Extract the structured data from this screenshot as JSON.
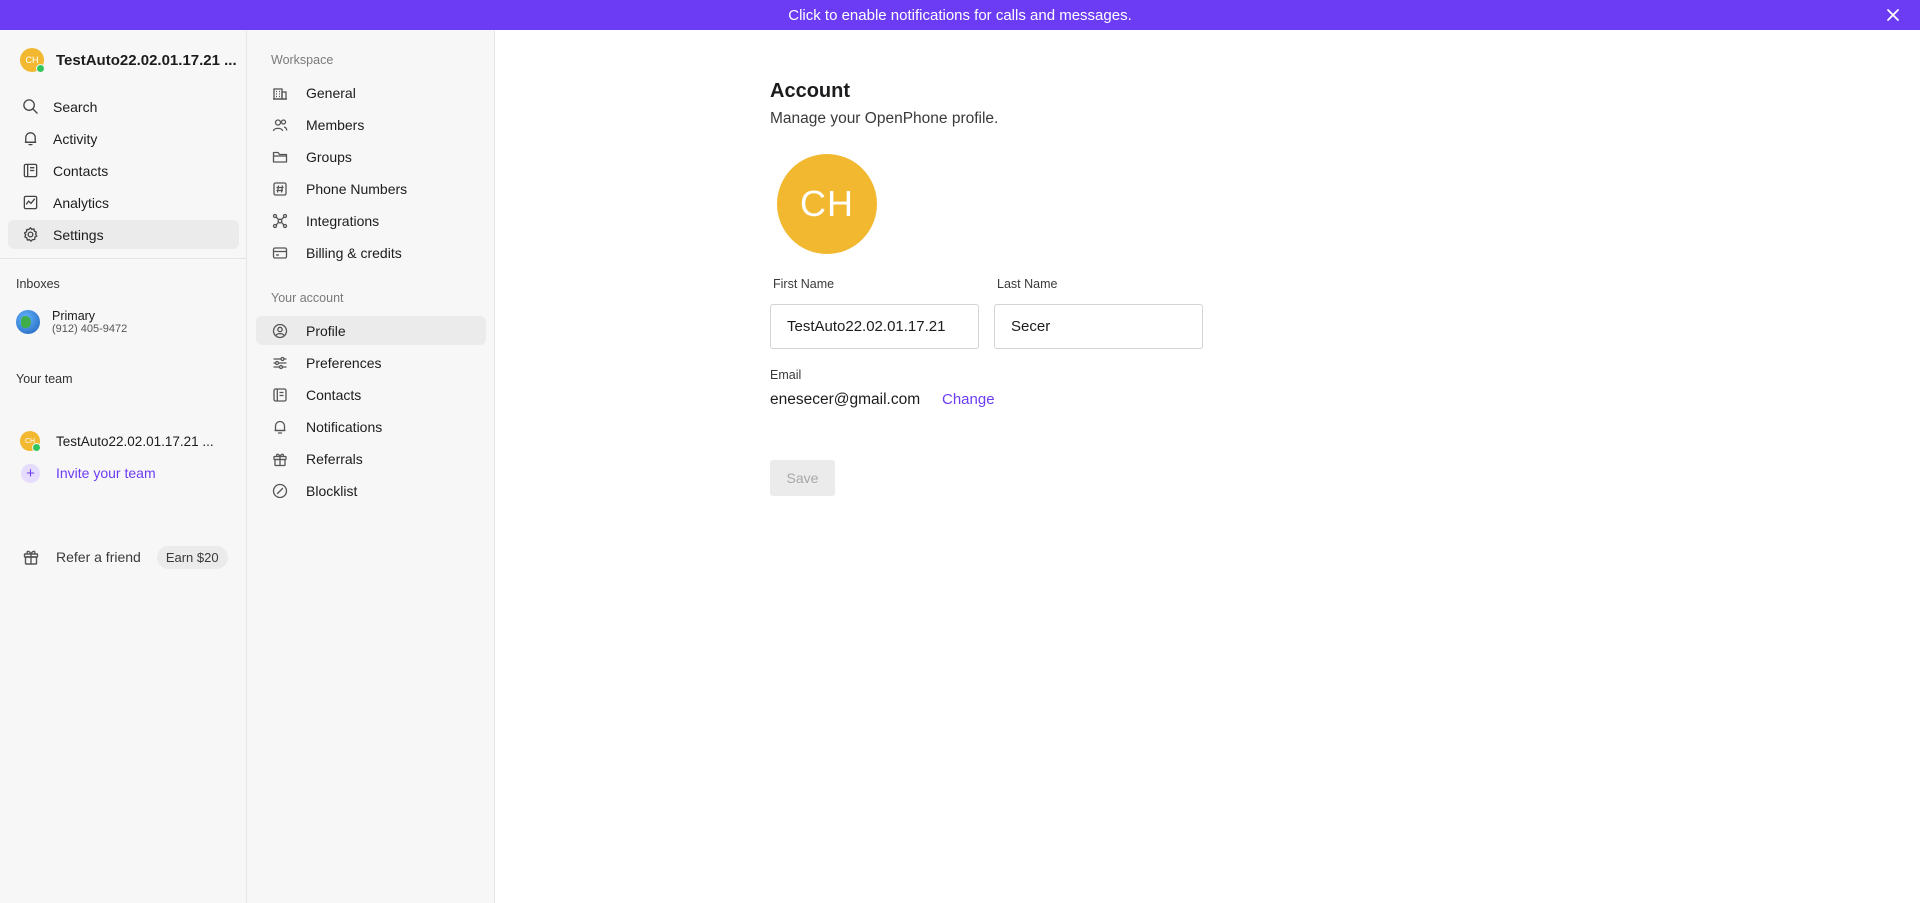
{
  "banner": {
    "text": "Click to enable notifications for calls and messages."
  },
  "org": {
    "initials": "CH",
    "name": "TestAuto22.02.01.17.21 ..."
  },
  "nav": [
    {
      "label": "Search",
      "icon": "search-icon"
    },
    {
      "label": "Activity",
      "icon": "bell-icon"
    },
    {
      "label": "Contacts",
      "icon": "contacts-icon"
    },
    {
      "label": "Analytics",
      "icon": "analytics-icon"
    },
    {
      "label": "Settings",
      "icon": "gear-icon",
      "active": true
    }
  ],
  "inboxes": {
    "label": "Inboxes",
    "items": [
      {
        "name": "Primary",
        "phone": "(912) 405-9472"
      }
    ]
  },
  "team": {
    "label": "Your team",
    "member": {
      "initials": "CH",
      "name": "TestAuto22.02.01.17.21 ..."
    },
    "invite_label": "Invite your team"
  },
  "refer": {
    "label": "Refer a friend",
    "badge": "Earn $20"
  },
  "settings_nav": {
    "workspace_label": "Workspace",
    "workspace_items": [
      {
        "label": "General",
        "icon": "building-icon"
      },
      {
        "label": "Members",
        "icon": "members-icon"
      },
      {
        "label": "Groups",
        "icon": "folder-icon"
      },
      {
        "label": "Phone Numbers",
        "icon": "hash-icon"
      },
      {
        "label": "Integrations",
        "icon": "integrations-icon"
      },
      {
        "label": "Billing & credits",
        "icon": "card-icon"
      }
    ],
    "account_label": "Your account",
    "account_items": [
      {
        "label": "Profile",
        "icon": "profile-icon",
        "active": true
      },
      {
        "label": "Preferences",
        "icon": "sliders-icon"
      },
      {
        "label": "Contacts",
        "icon": "contacts-icon"
      },
      {
        "label": "Notifications",
        "icon": "bell-icon"
      },
      {
        "label": "Referrals",
        "icon": "gift-icon"
      },
      {
        "label": "Blocklist",
        "icon": "block-icon"
      }
    ]
  },
  "account": {
    "title": "Account",
    "subtitle": "Manage your OpenPhone profile.",
    "avatar_initials": "CH",
    "first_name_label": "First Name",
    "first_name": "TestAuto22.02.01.17.21",
    "last_name_label": "Last Name",
    "last_name": "Secer",
    "email_label": "Email",
    "email": "enesecer@gmail.com",
    "change_label": "Change",
    "save_label": "Save"
  },
  "colors": {
    "accent": "#6c3cf5",
    "avatar": "#f2b830",
    "online": "#32c55b"
  }
}
